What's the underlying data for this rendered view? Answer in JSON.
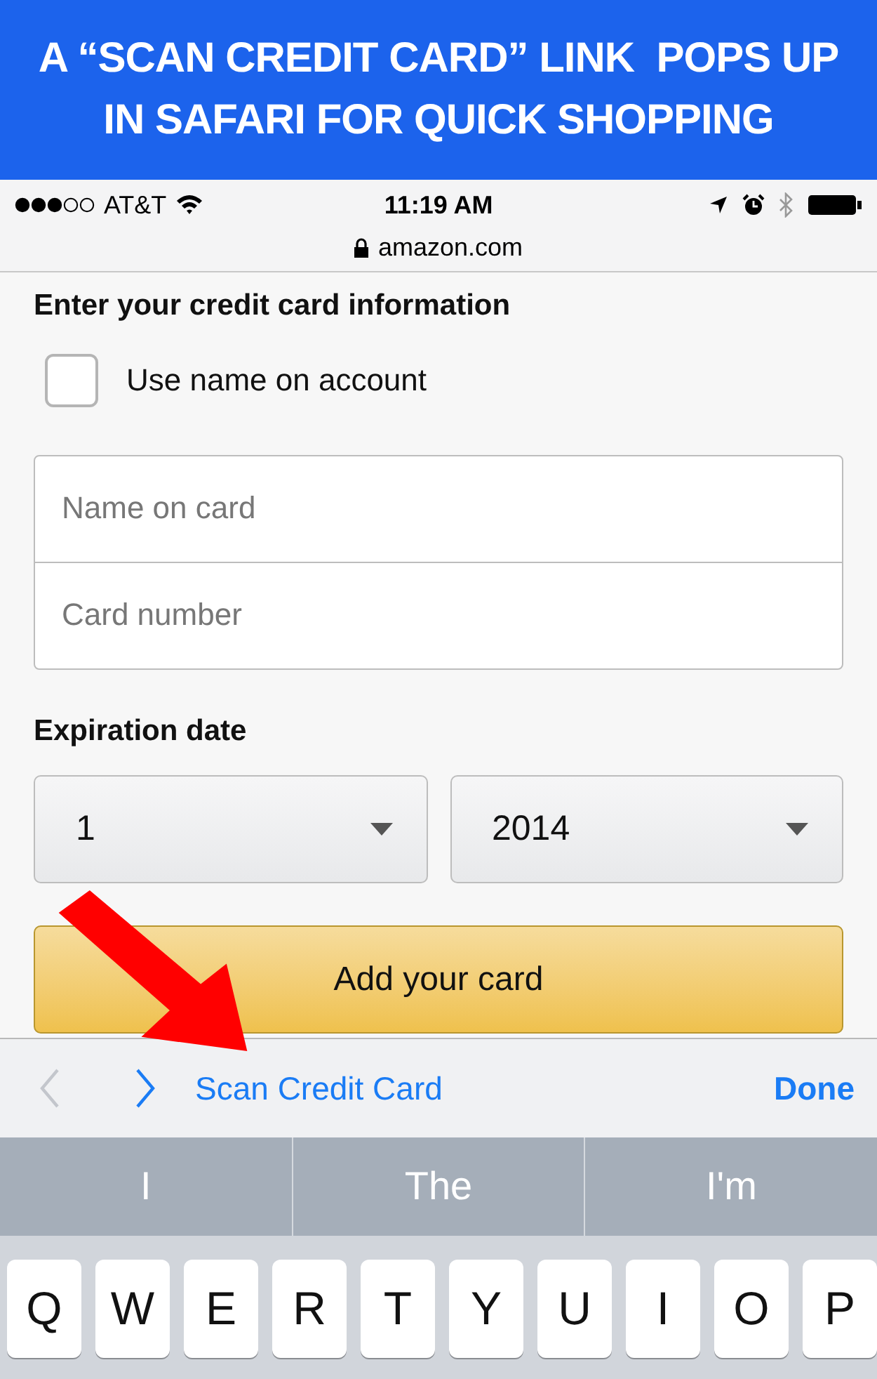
{
  "banner": {
    "lines": [
      "A “SCAN CREDIT CARD” LINK  POPS UP",
      "IN SAFARI FOR QUICK SHOPPING"
    ]
  },
  "status_bar": {
    "carrier": "AT&T",
    "time": "11:19 AM"
  },
  "address_bar": {
    "url": "amazon.com",
    "secure": true
  },
  "form": {
    "heading": "Enter your credit card information",
    "checkbox": {
      "label": "Use name on account",
      "checked": false
    },
    "fields": [
      {
        "placeholder": "Name on card"
      },
      {
        "placeholder": "Card number"
      }
    ],
    "expiration_label": "Expiration date",
    "selects": [
      {
        "value": "1"
      },
      {
        "value": "2014"
      }
    ],
    "submit": "Add your card"
  },
  "accessory_bar": {
    "prev_disabled": true,
    "next_disabled": false,
    "link": "Scan Credit Card",
    "done": "Done"
  },
  "suggestions": [
    {
      "text": "I"
    },
    {
      "text": "The"
    },
    {
      "text": "I'm"
    }
  ],
  "keys": [
    "Q",
    "W",
    "E",
    "R",
    "T",
    "Y",
    "U",
    "I",
    "O",
    "P"
  ]
}
